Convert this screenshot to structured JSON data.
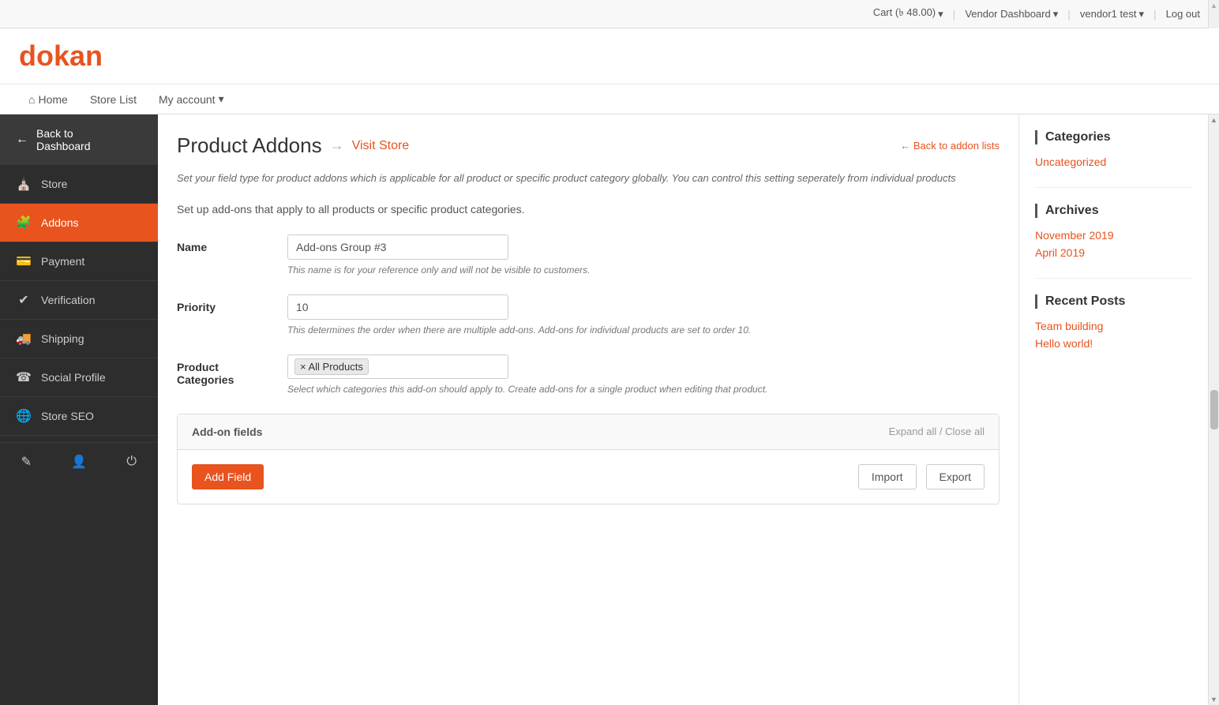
{
  "topbar": {
    "cart_label": "Cart (৳ 48.00)",
    "cart_dropdown": "▾",
    "vendor_dashboard_label": "Vendor Dashboard",
    "vendor_dashboard_dropdown": "▾",
    "user_label": "vendor1 test",
    "user_dropdown": "▾",
    "logout_label": "Log out"
  },
  "logo": {
    "text_d": "d",
    "text_rest": "okan"
  },
  "nav": {
    "home_label": "Home",
    "store_list_label": "Store List",
    "my_account_label": "My account",
    "my_account_dropdown": "▾"
  },
  "sidebar": {
    "back_label": "Back to\nDashboard",
    "store_label": "Store",
    "addons_label": "Addons",
    "payment_label": "Payment",
    "verification_label": "Verification",
    "shipping_label": "Shipping",
    "social_profile_label": "Social Profile",
    "store_seo_label": "Store SEO"
  },
  "page": {
    "title": "Product Addons",
    "visit_store_label": "→ Visit Store",
    "back_to_addon_lists_label": "← Back to addon lists",
    "description": "Set your field type for product addons which is applicable for all product or specific product category globally. You can control this setting seperately from individual products",
    "subtext": "Set up add-ons that apply to all products or specific product categories.",
    "form": {
      "name_label": "Name",
      "name_value": "Add-ons Group #3",
      "name_hint": "This name is for your reference only and will not be visible to customers.",
      "priority_label": "Priority",
      "priority_value": "10",
      "priority_hint": "This determines the order when there are multiple add-ons. Add-ons for individual products are set to order 10.",
      "product_categories_label": "Product\nCategories",
      "product_categories_tag": "× All Products",
      "product_categories_hint": "Select which categories this add-on should apply to. Create add-ons for a single product when editing that product."
    },
    "addon_fields": {
      "title": "Add-on fields",
      "expand_all": "Expand all",
      "divider": " / ",
      "close_all": "Close all",
      "add_field_label": "Add Field",
      "import_label": "Import",
      "export_label": "Export"
    }
  },
  "right_sidebar": {
    "categories_title": "Categories",
    "uncategorized_label": "Uncategorized",
    "archives_title": "Archives",
    "november_2019_label": "November 2019",
    "april_2019_label": "April 2019",
    "recent_posts_title": "Recent Posts",
    "team_building_label": "Team building",
    "hello_world_label": "Hello world!"
  }
}
